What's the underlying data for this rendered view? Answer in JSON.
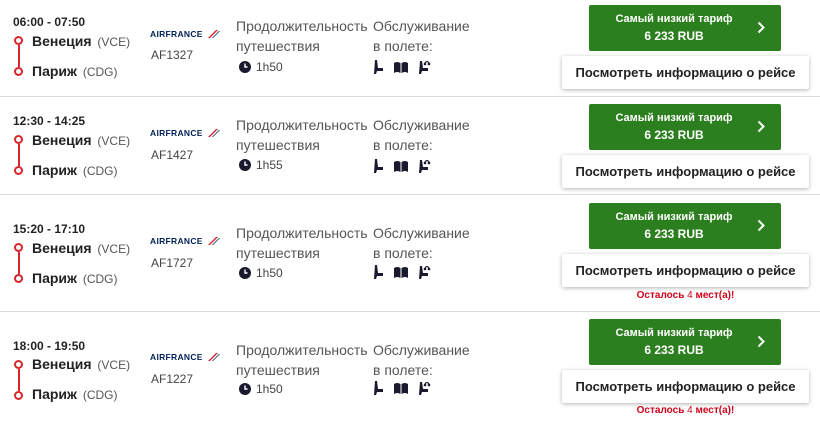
{
  "flights": [
    {
      "time": "06:00 - 07:50",
      "from_city": "Венеция",
      "from_code": "(VCE)",
      "to_city": "Париж",
      "to_code": "(CDG)",
      "airline": "AIRFRANCE",
      "flight_no": "AF1327",
      "duration_label_1": "Продолжительность",
      "duration_label_2": "путешествия",
      "duration": "1h50",
      "service_label_1": "Обслуживание",
      "service_label_2": "в полете:",
      "fare_label": "Самый низкий тариф",
      "price": "6 233 RUB",
      "info_button": "Посмотреть информацию о рейсе",
      "seats_prefix": "",
      "seats_num": "",
      "seats_suffix": ""
    },
    {
      "time": "12:30 - 14:25",
      "from_city": "Венеция",
      "from_code": "(VCE)",
      "to_city": "Париж",
      "to_code": "(CDG)",
      "airline": "AIRFRANCE",
      "flight_no": "AF1427",
      "duration_label_1": "Продолжительность",
      "duration_label_2": "путешествия",
      "duration": "1h55",
      "service_label_1": "Обслуживание",
      "service_label_2": "в полете:",
      "fare_label": "Самый низкий тариф",
      "price": "6 233 RUB",
      "info_button": "Посмотреть информацию о рейсе",
      "seats_prefix": "",
      "seats_num": "",
      "seats_suffix": ""
    },
    {
      "time": "15:20 - 17:10",
      "from_city": "Венеция",
      "from_code": "(VCE)",
      "to_city": "Париж",
      "to_code": "(CDG)",
      "airline": "AIRFRANCE",
      "flight_no": "AF1727",
      "duration_label_1": "Продолжительность",
      "duration_label_2": "путешествия",
      "duration": "1h50",
      "service_label_1": "Обслуживание",
      "service_label_2": "в полете:",
      "fare_label": "Самый низкий тариф",
      "price": "6 233 RUB",
      "info_button": "Посмотреть информацию о рейсе",
      "seats_prefix": "Осталось ",
      "seats_num": "4",
      "seats_suffix": " мест(а)!"
    },
    {
      "time": "18:00 - 19:50",
      "from_city": "Венеция",
      "from_code": "(VCE)",
      "to_city": "Париж",
      "to_code": "(CDG)",
      "airline": "AIRFRANCE",
      "flight_no": "AF1227",
      "duration_label_1": "Продолжительность",
      "duration_label_2": "путешествия",
      "duration": "1h50",
      "service_label_1": "Обслуживание",
      "service_label_2": "в полете:",
      "fare_label": "Самый низкий тариф",
      "price": "6 233 RUB",
      "info_button": "Посмотреть информацию о рейсе",
      "seats_prefix": "Осталось ",
      "seats_num": "4",
      "seats_suffix": " мест(а)!"
    }
  ],
  "icons": {
    "clock": "clock-icon",
    "seat": "seat-icon",
    "magazine": "magazine-icon",
    "chevron": "chevron-right-icon",
    "logo": "air-france-logo"
  },
  "colors": {
    "accent_green": "#2c7f1e",
    "route_red": "#d4262c",
    "alert_red": "#d0021b",
    "brand_navy": "#002157"
  }
}
